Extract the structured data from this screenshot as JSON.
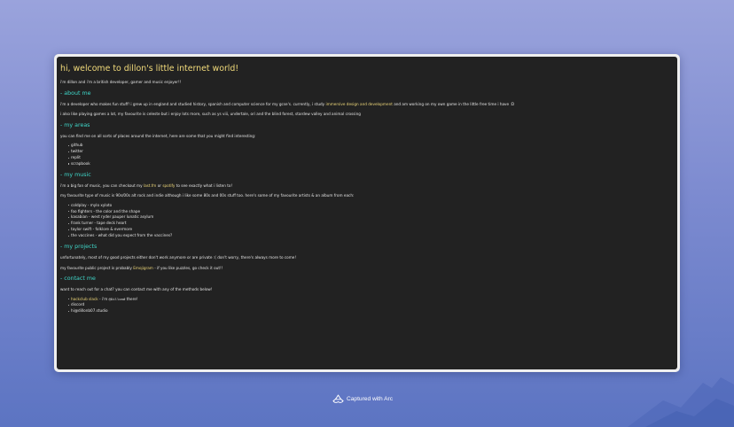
{
  "page": {
    "title": "hi, welcome to dillon's little internet world!",
    "intro": "i'm dillon and i'm a british developer, gamer and music enjoyer!!"
  },
  "about": {
    "heading": "- about me",
    "p1_before": "i'm a developer who makes fun stuff! i grew up in england and studied history, spanish and computer science for my gcse's. currently, i study ",
    "p1_link": "immersive design and development",
    "p1_after": " and am working on my own game in the little free time i have :D",
    "p2": "i also like playing games a lot, my favourite is celeste but i enjoy lots more, such as ys viii, undertale, ori and the blind forest, stardew valley and animal crossing"
  },
  "areas": {
    "heading": "- my areas",
    "intro": "you can find me on all sorts of places around the internet, here are some that you might find interesting:",
    "links": [
      "github",
      "twitter",
      "replit",
      "scrapbook"
    ]
  },
  "music": {
    "heading": "- my music",
    "p1_before": "i'm a big fan of music, you can checkout my ",
    "p1_link1": "last.fm",
    "p1_mid": " or ",
    "p1_link2": "spotify",
    "p1_after": " to see exactly what i listen to!",
    "p2": "my favourite type of music is 90s/00s alt rock and indie although i like some 80s and 00s stuff too. here's some of my favourite artists & an album from each:",
    "albums": [
      "coldplay - mylo xyloto",
      "foo fighters - the color and the shape",
      "kasabian - west ryder pauper lunatic asylum",
      "frank turner - tape deck heart",
      "taylor swift - folklore & evermore",
      "the vaccines - what did you expect from the vaccines?"
    ]
  },
  "projects": {
    "heading": "- my projects",
    "p1": "unfortunately, most of my good projects either don't work anymore or are private :( don't worry, there's always more to come!",
    "p2_before": "my favourite public project is probably ",
    "p2_link": "Emojigram",
    "p2_after": " - if you like puzzles, go check it out!!"
  },
  "contact": {
    "heading": "- contact me",
    "intro": "want to reach out for a chat? you can contact me with any of the methods below!",
    "slack_link": "hackclub slack",
    "slack_mid": " - i'm ",
    "slack_handle": "@Dillon#",
    "slack_after": " there!",
    "discord": "discord",
    "email": "hi@dillonb07.studio"
  },
  "footer": {
    "captured": "Captured with Arc"
  },
  "colors": {
    "accent_heading": "#3fd6c8",
    "accent_link": "#f0d97a",
    "page_bg": "#222222"
  }
}
